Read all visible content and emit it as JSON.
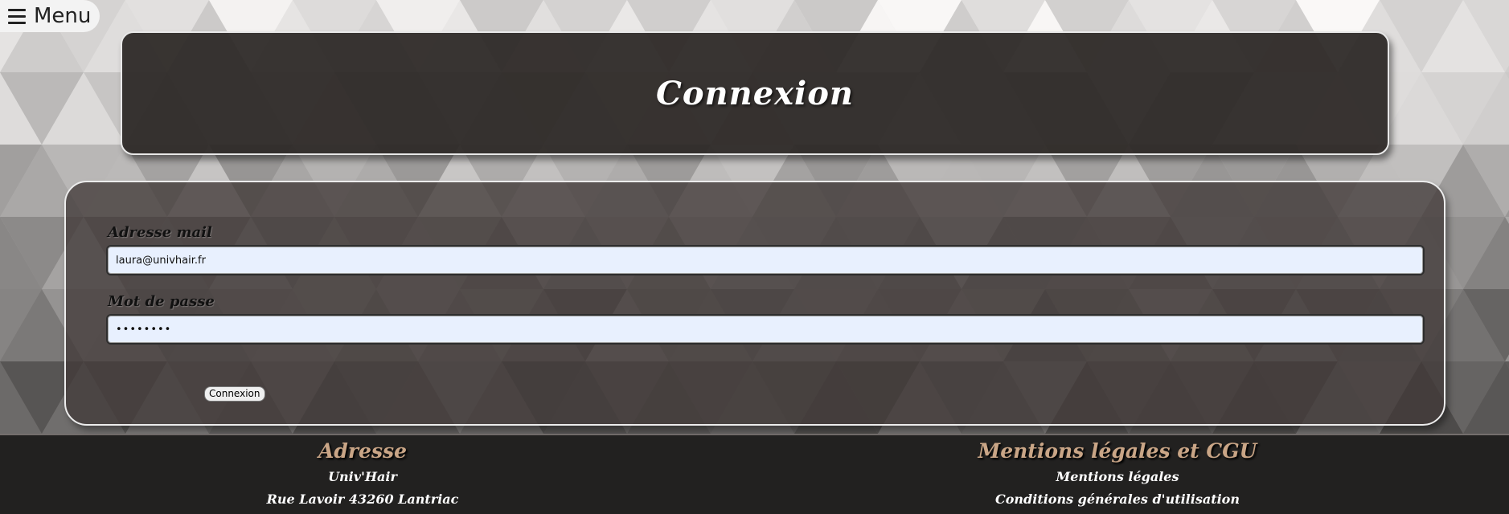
{
  "nav": {
    "menu_label": "Menu"
  },
  "header": {
    "title": "Connexion"
  },
  "form": {
    "email_label": "Adresse mail",
    "email_value": "laura@univhair.fr",
    "password_label": "Mot de passe",
    "password_value": "••••••••",
    "submit_label": "Connexion"
  },
  "footer": {
    "address": {
      "heading": "Adresse",
      "name": "Univ'Hair",
      "street": "Rue Lavoir 43260 Lantriac"
    },
    "legal": {
      "heading": "Mentions légales et CGU",
      "mentions_link": "Mentions légales",
      "cgu_link": "Conditions générales d'utilisation"
    }
  },
  "colors": {
    "footer_heading": "#c9a586",
    "footer_bg": "#222120",
    "card_bg": "#2d2826",
    "input_bg": "#e8f0fe"
  },
  "icons": {
    "menu": "hamburger-icon"
  }
}
